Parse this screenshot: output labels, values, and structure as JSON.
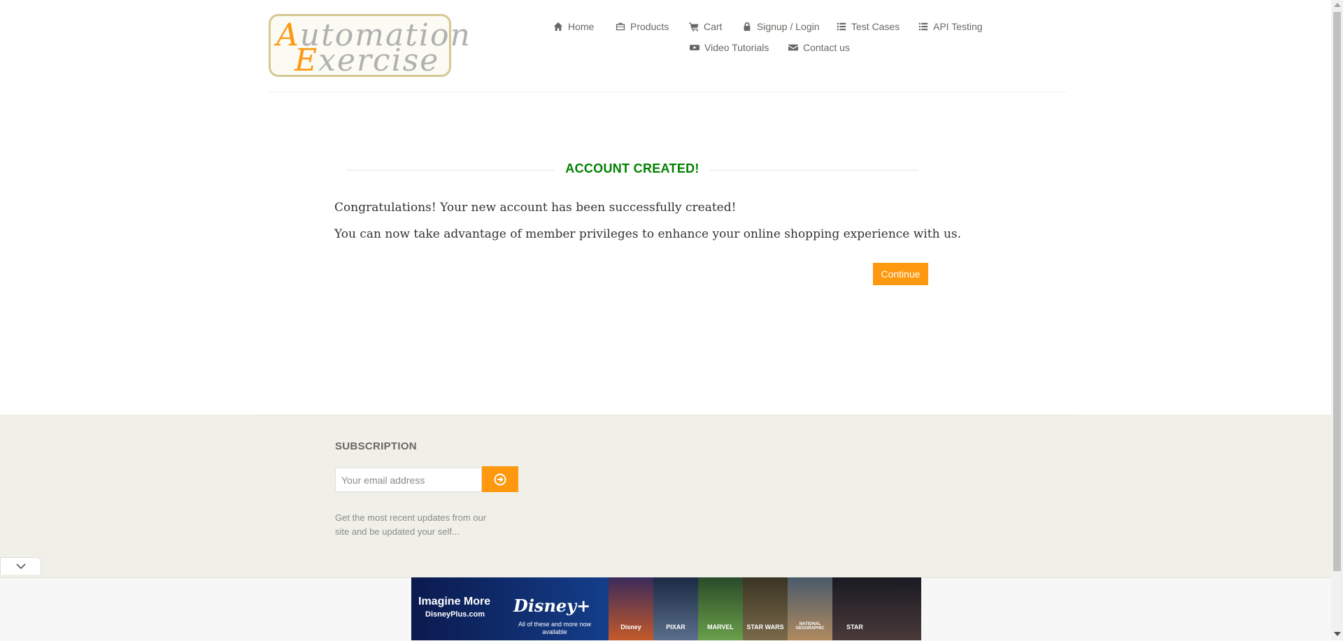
{
  "logo": {
    "line1_cap": "A",
    "line1_rest": "utomation",
    "line2_cap": "E",
    "line2_rest": "xercise"
  },
  "nav": {
    "items": [
      {
        "label": "Home",
        "icon": "home-icon"
      },
      {
        "label": "Products",
        "icon": "products-icon"
      },
      {
        "label": "Cart",
        "icon": "cart-icon"
      },
      {
        "label": "Signup / Login",
        "icon": "lock-icon"
      },
      {
        "label": "Test Cases",
        "icon": "list-icon"
      },
      {
        "label": "API Testing",
        "icon": "list-icon"
      },
      {
        "label": "Video Tutorials",
        "icon": "youtube-icon"
      },
      {
        "label": "Contact us",
        "icon": "envelope-icon"
      }
    ]
  },
  "main": {
    "title": "ACCOUNT CREATED!",
    "line1": "Congratulations! Your new account has been successfully created!",
    "line2": "You can now take advantage of member privileges to enhance your online shopping experience with us.",
    "continue_label": "Continue"
  },
  "footer": {
    "subscription_title": "SUBSCRIPTION",
    "email_placeholder": "Your email address",
    "description": "Get the most recent updates from our site and be updated your self..."
  },
  "ad": {
    "headline": "Imagine More",
    "url": "DisneyPlus.com",
    "brand": "Disney+",
    "subline": "All of these and more now available",
    "tiles": [
      "Disney",
      "PIXAR",
      "MARVEL",
      "STAR WARS",
      "NATIONAL GEOGRAPHIC",
      "STAR"
    ]
  },
  "colors": {
    "accent": "#fe980f",
    "success": "#008000",
    "text": "#696763",
    "footer_bg": "#f0f0e9"
  }
}
